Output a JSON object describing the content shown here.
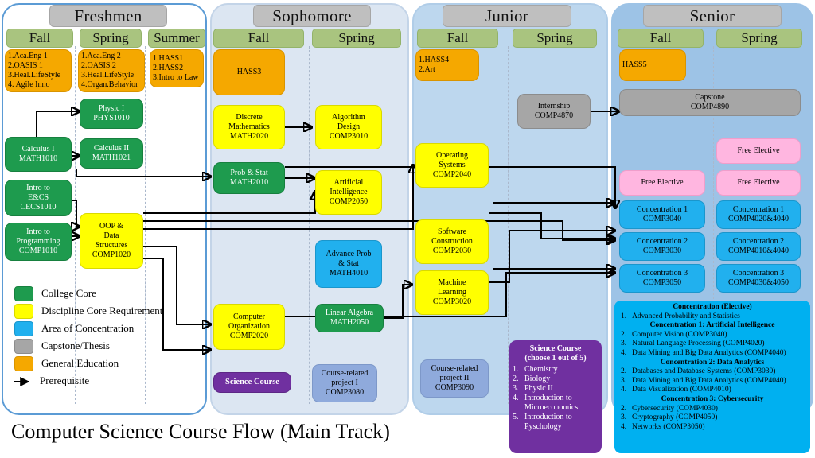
{
  "title": "Computer Science Course Flow (Main Track)",
  "colors": {
    "college_core": "#1e9b4e",
    "discipline_core": "#ffff00",
    "area_of_concentration": "#21b0ee",
    "capstone_thesis": "#a6a6a6",
    "general_education": "#f5a800",
    "free_elective": "#ffb6e0",
    "science_course": "#7030a0",
    "course_project": "#8faadc",
    "panel_freshmen": "#ffffff",
    "panel_sophomore": "#dce6f2",
    "panel_junior": "#bdd7ee",
    "panel_senior": "#9dc3e6",
    "year_title_chip": "#bfbfbf",
    "term_chip": "#a9c47f",
    "concentration_panel": "#00b0f0"
  },
  "years": [
    {
      "name": "Freshmen",
      "terms": [
        "Fall",
        "Spring",
        "Summer"
      ]
    },
    {
      "name": "Sophomore",
      "terms": [
        "Fall",
        "Spring"
      ]
    },
    {
      "name": "Junior",
      "terms": [
        "Fall",
        "Spring"
      ]
    },
    {
      "name": "Senior",
      "terms": [
        "Fall",
        "Spring"
      ]
    }
  ],
  "boxes": {
    "fresh_fall_gened": {
      "lines": [
        "1.Aca.Eng 1",
        "2.OASIS 1",
        "3.Heal.LifeStyle",
        "4. Agile  Inno"
      ]
    },
    "fresh_spring_gened": {
      "lines": [
        "1.Aca.Eng 2",
        "2.OASIS 2",
        "3.Heal.LifeStyle",
        "4.Organ.Behavior"
      ]
    },
    "fresh_summer_gened": {
      "lines": [
        "1.HASS1",
        "2.HASS2",
        "3.Intro to Law"
      ]
    },
    "physic1": {
      "lines": [
        "Physic I",
        "PHYS1010"
      ]
    },
    "calculus1": {
      "lines": [
        "Calculus I",
        "MATH1010"
      ]
    },
    "calculus2": {
      "lines": [
        "Calculus II",
        "MATH1021"
      ]
    },
    "intro_ecs": {
      "lines": [
        "Intro to",
        "E&CS",
        "CECS1010"
      ]
    },
    "intro_prog": {
      "lines": [
        "Intro to",
        "Programming",
        "COMP1010"
      ]
    },
    "oop_ds": {
      "lines": [
        "OOP &",
        "Data",
        "Structures",
        "COMP1020"
      ]
    },
    "hass3": {
      "lines": [
        "HASS3"
      ]
    },
    "discrete_math": {
      "lines": [
        "Discrete",
        "Mathematics",
        "MATH2020"
      ]
    },
    "algorithm": {
      "lines": [
        "Algorithm",
        "Design",
        "COMP3010"
      ]
    },
    "prob_stat": {
      "lines": [
        "Prob & Stat",
        "MATH2010"
      ]
    },
    "ai": {
      "lines": [
        "Artificial",
        "Intelligence",
        "COMP2050"
      ]
    },
    "adv_prob": {
      "lines": [
        "Advance  Prob",
        "& Stat",
        "MATH4010"
      ]
    },
    "comp_org": {
      "lines": [
        "Computer",
        "Organization",
        "COMP2020"
      ]
    },
    "linear_algebra": {
      "lines": [
        "Linear  Algebra",
        "MATH2050"
      ]
    },
    "science_course_box": {
      "lines": [
        "Science Course"
      ]
    },
    "project1": {
      "lines": [
        "Course-related",
        "project I",
        "COMP3080"
      ]
    },
    "jun_fall_gened": {
      "lines": [
        "1.HASS4",
        "2.Art"
      ]
    },
    "internship": {
      "lines": [
        "Internship",
        "COMP4870"
      ]
    },
    "operating_sys": {
      "lines": [
        "Operating",
        "Systems",
        "COMP2040"
      ]
    },
    "software_con": {
      "lines": [
        "Software",
        "Construction",
        "COMP2030"
      ]
    },
    "machine_learn": {
      "lines": [
        "Machine",
        "Learning",
        "COMP3020"
      ]
    },
    "project2": {
      "lines": [
        "Course-related",
        "project II",
        "COMP3090"
      ]
    },
    "hass5": {
      "lines": [
        "HASS5"
      ]
    },
    "capstone": {
      "lines": [
        "Capstone",
        "COMP4890"
      ]
    },
    "free_elective_sp_1": {
      "lines": [
        "Free Elective"
      ]
    },
    "free_elective_fa": {
      "lines": [
        "Free Elective"
      ]
    },
    "free_elective_sp_2": {
      "lines": [
        "Free Elective"
      ]
    },
    "conc1_fall": {
      "lines": [
        "Concentration  1",
        "COMP3040"
      ]
    },
    "conc2_fall": {
      "lines": [
        "Concentration  2",
        "COMP3030"
      ]
    },
    "conc3_fall": {
      "lines": [
        "Concentration  3",
        "COMP3050"
      ]
    },
    "conc1_spring": {
      "lines": [
        "Concentration  1",
        "COMP4020&4040"
      ]
    },
    "conc2_spring": {
      "lines": [
        "Concentration  2",
        "COMP4010&4040"
      ]
    },
    "conc3_spring": {
      "lines": [
        "Concentration  3",
        "COMP4030&4050"
      ]
    }
  },
  "legend": {
    "items": [
      {
        "label": "College Core",
        "color": "#1e9b4e",
        "type": "swatch"
      },
      {
        "label": "Discipline  Core Requirement",
        "color": "#ffff00",
        "type": "swatch"
      },
      {
        "label": "Area of Concentration",
        "color": "#21b0ee",
        "type": "swatch"
      },
      {
        "label": "Capstone/Thesis",
        "color": "#a6a6a6",
        "type": "swatch"
      },
      {
        "label": "General Education",
        "color": "#f5a800",
        "type": "swatch"
      },
      {
        "label": "Prerequisite",
        "color": "#000000",
        "type": "arrow"
      }
    ]
  },
  "science_panel": {
    "title_line1": "Science Course",
    "title_line2": "(choose 1 out of 5)",
    "items": [
      {
        "num": "1.",
        "text": "Chemistry"
      },
      {
        "num": "2.",
        "text": "Biology"
      },
      {
        "num": "3.",
        "text": "Physic II"
      },
      {
        "num": "4.",
        "text": "Introduction  to Microeconomics"
      },
      {
        "num": "5.",
        "text": "Introduction  to Pyschology"
      }
    ]
  },
  "concentration_panel": {
    "heading": "Concentration (Elective)",
    "intro_item": {
      "num": "1.",
      "text": "Advanced Probability and Statistics"
    },
    "groups": [
      {
        "heading": "Concentration 1: Artificial Intelligence",
        "items": [
          {
            "num": "2.",
            "text": "Computer Vision (COMP3040)"
          },
          {
            "num": "3.",
            "text": "Natural  Language  Processing (COMP4020)"
          },
          {
            "num": "4.",
            "text": "Data Mining  and Big Data Analytics (COMP4040)"
          }
        ]
      },
      {
        "heading": "Concentration 2: Data Analytics",
        "items": [
          {
            "num": "2.",
            "text": "Databases and Database Systems (COMP3030)"
          },
          {
            "num": "3.",
            "text": "Data Mining  and Big Data Analytics (COMP4040)"
          },
          {
            "num": "4.",
            "text": "Data Visualization  (COMP4010)"
          }
        ]
      },
      {
        "heading": "Concentration 3: Cybersecurity",
        "items": [
          {
            "num": "2.",
            "text": "Cybersecurity (COMP4030)"
          },
          {
            "num": "3.",
            "text": "Cryptography (COMP4050)"
          },
          {
            "num": "4.",
            "text": "Networks (COMP3050)"
          }
        ]
      }
    ]
  }
}
